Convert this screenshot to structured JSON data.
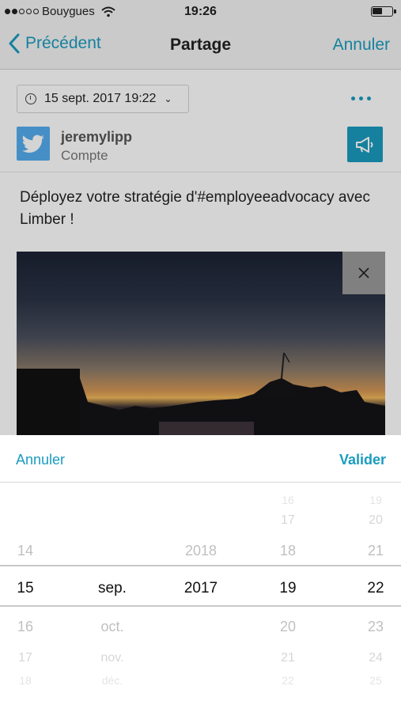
{
  "status_bar": {
    "carrier": "Bouygues",
    "time": "19:26"
  },
  "nav": {
    "back_label": "Précédent",
    "title": "Partage",
    "cancel_label": "Annuler"
  },
  "post": {
    "date_label": "15 sept. 2017 19:22",
    "account": {
      "name": "jeremylipp",
      "type": "Compte"
    },
    "text": "Déployez votre stratégie d'#employeeadvocacy avec Limber !"
  },
  "picker": {
    "cancel_label": "Annuler",
    "confirm_label": "Valider",
    "columns": {
      "day": {
        "above": [
          "14"
        ],
        "selected": "15",
        "below": [
          "16",
          "17",
          "18"
        ]
      },
      "month": {
        "above": [],
        "selected": "sep.",
        "below": [
          "oct.",
          "nov.",
          "déc."
        ]
      },
      "year": {
        "above": [
          "2018"
        ],
        "selected": "2017",
        "below": []
      },
      "hour": {
        "above": [
          "16",
          "17",
          "18"
        ],
        "selected": "19",
        "below": [
          "20",
          "21",
          "22"
        ]
      },
      "minute": {
        "above": [
          "19",
          "20",
          "21"
        ],
        "selected": "22",
        "below": [
          "23",
          "24",
          "25"
        ]
      }
    }
  },
  "colors": {
    "accent": "#1a9cbf",
    "twitter": "#55acee"
  },
  "icons": [
    "back-chevron-icon",
    "wifi-icon",
    "battery-icon",
    "clock-icon",
    "chevron-down-icon",
    "more-icon",
    "twitter-icon",
    "megaphone-icon",
    "close-icon"
  ]
}
